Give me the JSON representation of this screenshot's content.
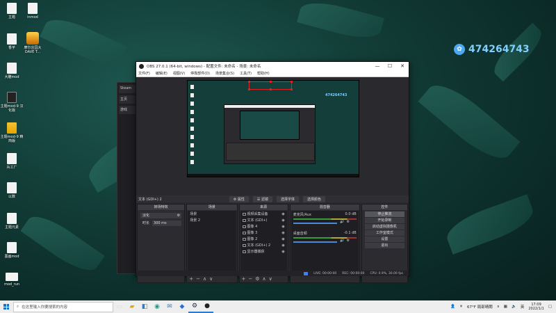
{
  "desktop": {
    "icons": [
      {
        "label": "主题",
        "kind": "file"
      },
      {
        "label": "inmod",
        "kind": "file"
      },
      {
        "label": "香芋",
        "kind": "file"
      },
      {
        "label": "摩尔庄园大 DAVE T...",
        "kind": "game"
      },
      {
        "label": "大雕mod",
        "kind": "file"
      },
      {
        "label": "主题mod-9 汉化版",
        "kind": "dark"
      },
      {
        "label": "主题mod-9 精简版",
        "kind": "yellow"
      },
      {
        "label": "兵工厂",
        "kind": "file"
      },
      {
        "label": "以数",
        "kind": "file"
      },
      {
        "label": "主题元素",
        "kind": "file"
      },
      {
        "label": "墨画mod",
        "kind": "file"
      },
      {
        "label": "mod_run",
        "kind": "file"
      }
    ],
    "watermark": "474264743"
  },
  "bg_app": {
    "rows": [
      "Steam",
      "主页",
      "游戏"
    ]
  },
  "obs": {
    "title": "OBS 27.0.1 (64-bit, windows) - 配置文件: 未命名 - 场景: 未命名",
    "window_controls": [
      "—",
      "☐",
      "✕"
    ],
    "menu": [
      "文件(F)",
      "编辑(E)",
      "视图(V)",
      "停靠部件(D)",
      "场景集合(S)",
      "工具(T)",
      "帮助(H)"
    ],
    "preview_watermark": "474264743",
    "source_strip": {
      "label": "文本 (GDI+) 2",
      "buttons": [
        "⚙ 属性",
        "☰ 滤镜",
        "选择字体",
        "选择颜色"
      ]
    },
    "docks": {
      "transitions": {
        "title": "转场特效",
        "type": "淡化",
        "duration_label": "时长",
        "duration_value": "300 ms"
      },
      "scenes": {
        "title": "场景",
        "items": [
          "场景",
          "场景 2"
        ]
      },
      "sources": {
        "title": "来源",
        "items": [
          "视频采集设备",
          "文本 (GDI+)",
          "图像 4",
          "图像 3",
          "图像 2",
          "文本 (GDI+) 2",
          "显示器捕获"
        ]
      },
      "mixer": {
        "title": "混音器",
        "channels": [
          {
            "name": "麦克风/Aux",
            "db": "0.0 dB"
          },
          {
            "name": "桌面音频",
            "db": "-0.1 dB"
          }
        ]
      },
      "controls": {
        "title": "控件",
        "buttons": [
          "停止推流",
          "开始录制",
          "启动虚拟摄像机",
          "工作室模式",
          "设置",
          "退出"
        ]
      }
    },
    "status": {
      "live": "LIVE: 00:00:00",
      "rec": "REC: 00:00:00",
      "cpu": "CPU: 0.9%, 30.00 fps"
    }
  },
  "taskbar": {
    "search_placeholder": "在这里输入你要搜索的内容",
    "weather": "67°F 局部晴朗",
    "ime": "英",
    "time": "17:09",
    "date": "2022/1/1"
  }
}
